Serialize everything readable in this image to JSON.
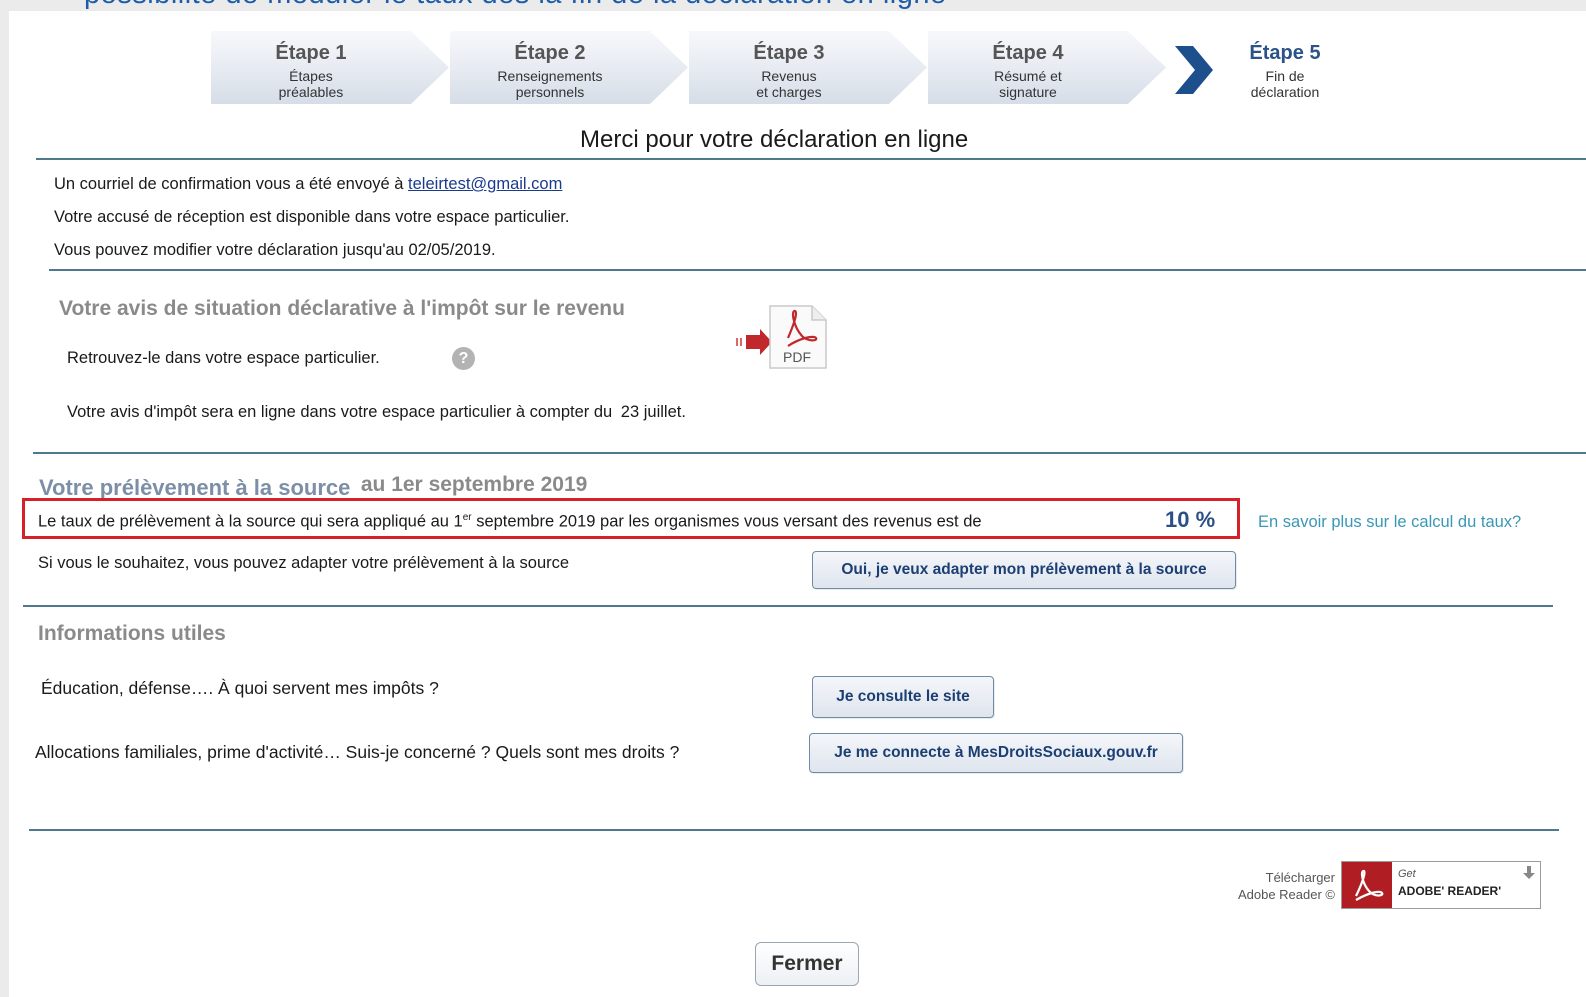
{
  "caption": "possibilité de moduler le taux dès la fin de la déclaration en ligne",
  "steps": [
    {
      "title": "Étape 1",
      "sub1": "Étapes",
      "sub2": "préalables"
    },
    {
      "title": "Étape 2",
      "sub1": "Renseignements",
      "sub2": "personnels"
    },
    {
      "title": "Étape 3",
      "sub1": "Revenus",
      "sub2": "et charges"
    },
    {
      "title": "Étape 4",
      "sub1": "Résumé et",
      "sub2": "signature"
    },
    {
      "title": "Étape 5",
      "sub1": "Fin de",
      "sub2": "déclaration"
    }
  ],
  "colors": {
    "accent": "#2b5387",
    "highlight_border": "#d6202a",
    "divider": "#4e7a8c",
    "link": "#3a97b5"
  },
  "main": {
    "title": "Merci pour votre déclaration en ligne",
    "confirm_text": "Un courriel de confirmation vous a été envoyé à",
    "email": "teleirtest@gmail.com",
    "receipt": "Votre accusé de réception est disponible dans votre espace particulier.",
    "modify": "Vous pouvez modifier votre déclaration jusqu'au 02/05/2019."
  },
  "avis": {
    "heading": "Votre avis de situation déclarative à l'impôt sur le revenu",
    "retrieve": "Retrouvez-le dans votre espace particulier.",
    "help_icon": "?",
    "pdf_label": "PDF",
    "online": "Votre avis d'impôt sera en ligne dans votre espace particulier à compter du",
    "online_date": "23 juillet."
  },
  "pas": {
    "heading": "Votre prélèvement à la source",
    "heading_date": "au 1er septembre 2019",
    "rate_text_1": "Le taux de prélèvement à la source qui sera appliqué au 1",
    "rate_sup": "er",
    "rate_text_2": "septembre 2019 par les organismes vous versant des revenus est de",
    "rate_value": "10 %",
    "learn_more": "En savoir plus sur le calcul du taux?",
    "adapt_text": "Si vous le souhaitez, vous pouvez adapter votre prélèvement à la source",
    "adapt_button": "Oui, je veux adapter mon prélèvement à la source"
  },
  "infos": {
    "heading": "Informations utiles",
    "q1": "Éducation, défense…. À quoi servent mes impôts ?",
    "btn1": "Je consulte le site",
    "q2": "Allocations familiales, prime d'activité… Suis-je concerné ? Quels sont mes droits ?",
    "btn2": "Je me connecte à MesDroitsSociaux.gouv.fr"
  },
  "adobe": {
    "line1": "Télécharger",
    "line2": "Adobe Reader ©",
    "get": "Get",
    "product": "ADOBE' READER'"
  },
  "close_button": "Fermer"
}
